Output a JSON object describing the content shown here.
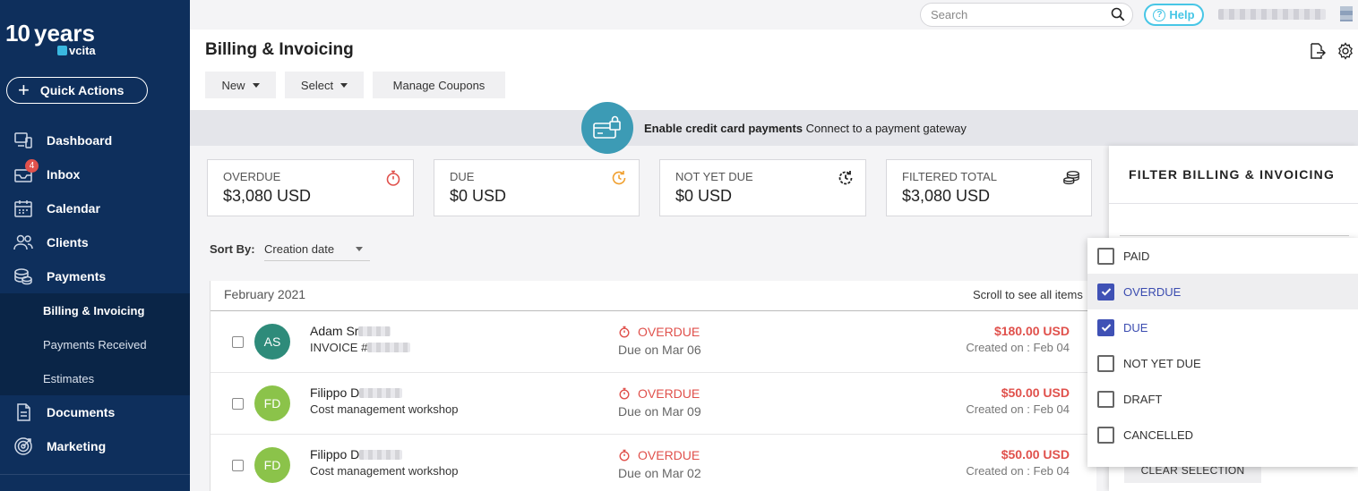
{
  "logo": {
    "ten": "10",
    "years": "years",
    "brand": "vcita"
  },
  "quick_actions": {
    "label": "Quick Actions"
  },
  "nav": {
    "items": [
      {
        "label": "Dashboard"
      },
      {
        "label": "Inbox",
        "badge": "4"
      },
      {
        "label": "Calendar"
      },
      {
        "label": "Clients"
      },
      {
        "label": "Payments"
      }
    ],
    "sub_items": [
      {
        "label": "Billing & Invoicing"
      },
      {
        "label": "Payments Received"
      },
      {
        "label": "Estimates"
      }
    ],
    "items_after": [
      {
        "label": "Documents"
      },
      {
        "label": "Marketing"
      }
    ]
  },
  "topbar": {
    "search_placeholder": "Search",
    "help_label": "Help"
  },
  "header": {
    "title": "Billing & Invoicing",
    "new_label": "New",
    "select_label": "Select",
    "coupons_label": "Manage Coupons"
  },
  "banner": {
    "bold": "Enable credit card payments",
    "text": " Connect to a payment gateway"
  },
  "cards": [
    {
      "label": "OVERDUE",
      "value": "$3,080 USD",
      "icon": "stopwatch-icon",
      "color": "#e0514c"
    },
    {
      "label": "DUE",
      "value": "$0 USD",
      "icon": "clock-refresh-icon",
      "color": "#f0a030"
    },
    {
      "label": "NOT YET DUE",
      "value": "$0 USD",
      "icon": "clock-forward-icon",
      "color": "#222222"
    },
    {
      "label": "FILTERED TOTAL",
      "value": "$3,080 USD",
      "icon": "coins-icon",
      "color": "#222222"
    }
  ],
  "sort": {
    "label": "Sort By:",
    "value": "Creation date"
  },
  "list": {
    "month": "February 2021",
    "scroll_hint": "Scroll to see all items",
    "rows": [
      {
        "initials": "AS",
        "avatar_color": "#2e8b7a",
        "name": "Adam Sr",
        "sub": "INVOICE #",
        "status": "OVERDUE",
        "due": "Due on Mar 06",
        "amount": "$180.00 USD",
        "created": "Created on : Feb 04"
      },
      {
        "initials": "FD",
        "avatar_color": "#8bc34a",
        "name": "Filippo D",
        "sub": "Cost management workshop",
        "status": "OVERDUE",
        "due": "Due on Mar 09",
        "amount": "$50.00 USD",
        "created": "Created on : Feb 04"
      },
      {
        "initials": "FD",
        "avatar_color": "#8bc34a",
        "name": "Filippo D",
        "sub": "Cost management workshop",
        "status": "OVERDUE",
        "due": "Due on Mar 02",
        "amount": "$50.00 USD",
        "created": "Created on : Feb 04"
      }
    ]
  },
  "filter": {
    "title": "FILTER BILLING & INVOICING",
    "clear_label": "CLEAR SELECTION",
    "options": [
      {
        "label": "PAID",
        "checked": false
      },
      {
        "label": "OVERDUE",
        "checked": true
      },
      {
        "label": "DUE",
        "checked": true
      },
      {
        "label": "NOT YET DUE",
        "checked": false
      },
      {
        "label": "DRAFT",
        "checked": false
      },
      {
        "label": "CANCELLED",
        "checked": false
      }
    ]
  }
}
